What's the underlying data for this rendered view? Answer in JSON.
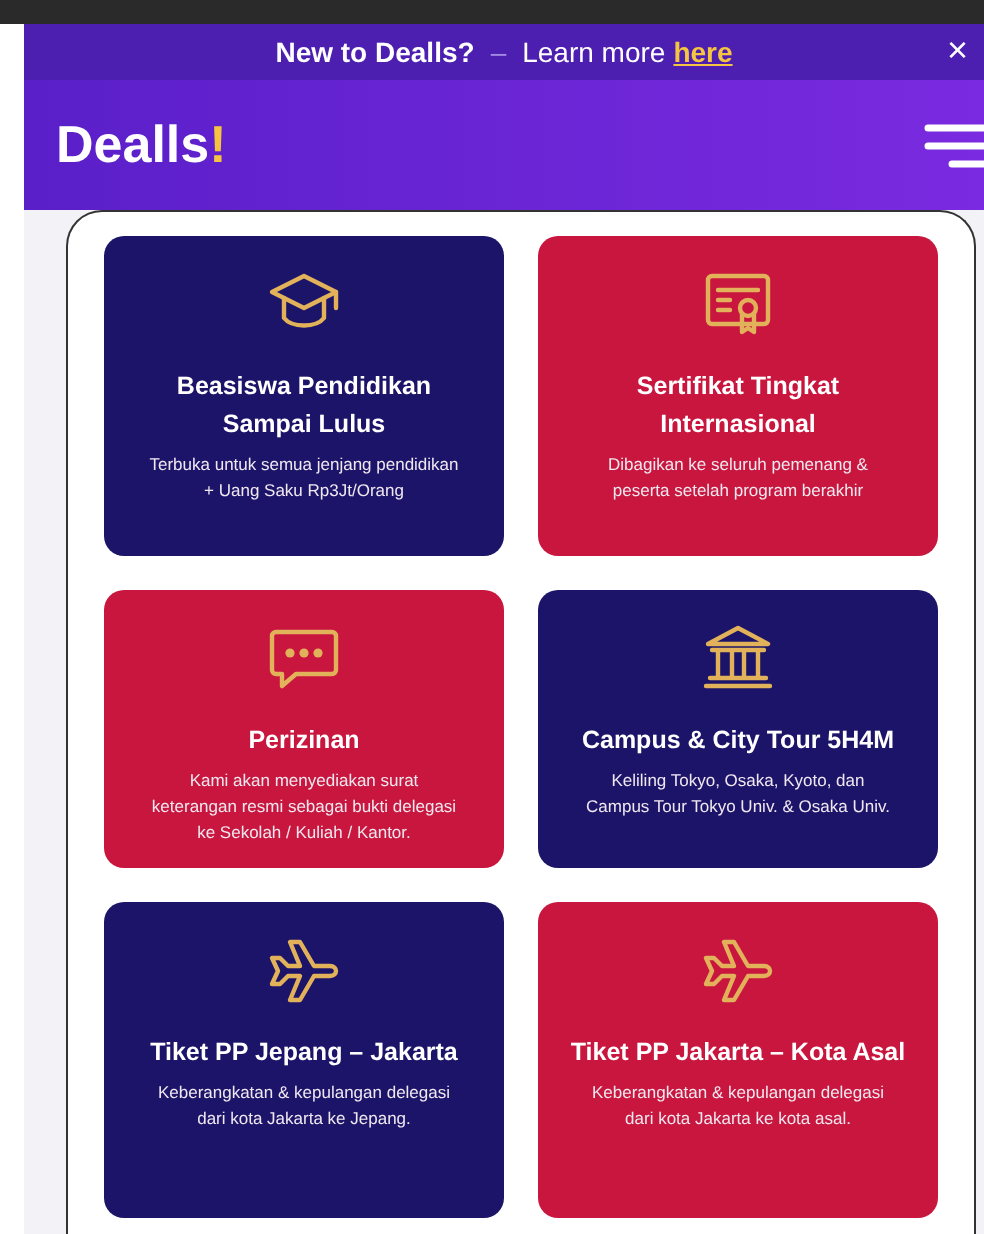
{
  "banner": {
    "question": "New to Dealls?",
    "separator": "–",
    "prompt": "Learn more",
    "link": "here",
    "close": "×"
  },
  "header": {
    "logo": "Dealls",
    "logo_mark": "!"
  },
  "cards": [
    {
      "kind": "graduation",
      "color": "#1c1468",
      "title": "Beasiswa Pendidikan Sampai Lulus",
      "description": "Terbuka untuk semua jenjang pendidikan + Uang Saku Rp3Jt/Orang"
    },
    {
      "kind": "certificate",
      "color": "#c8163e",
      "title": "Sertifikat Tingkat Internasional",
      "description": "Dibagikan ke seluruh pemenang & peserta setelah program berakhir"
    },
    {
      "kind": "chat",
      "color": "#c8163e",
      "title": "Perizinan",
      "description": "Kami akan menyediakan surat keterangan resmi sebagai bukti delegasi ke Sekolah / Kuliah / Kantor."
    },
    {
      "kind": "building",
      "color": "#1c1468",
      "title": "Campus & City Tour 5H4M",
      "description": "Keliling Tokyo, Osaka, Kyoto, dan Campus Tour Tokyo Univ. & Osaka Univ."
    },
    {
      "kind": "plane",
      "color": "#1c1468",
      "title": "Tiket PP Jepang – Jakarta",
      "description": "Keberangkatan & kepulangan delegasi dari kota Jakarta ke Jepang."
    },
    {
      "kind": "plane",
      "color": "#c8163e",
      "title": "Tiket PP Jakarta – Kota Asal",
      "description": "Keberangkatan & kepulangan delegasi dari kota Jakarta ke kota asal."
    }
  ]
}
